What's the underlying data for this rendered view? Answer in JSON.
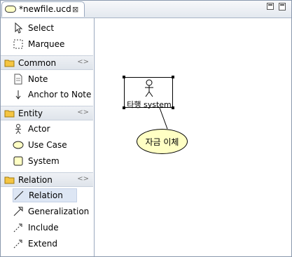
{
  "editor": {
    "tab_title": "*newfile.ucd",
    "close_glyph": "⊠"
  },
  "palette": {
    "tools": [
      {
        "label": "Select",
        "icon": "arrow-cursor-icon"
      },
      {
        "label": "Marquee",
        "icon": "marquee-icon"
      }
    ],
    "sections": [
      {
        "title": "Common",
        "items": [
          {
            "label": "Note",
            "icon": "note-icon"
          },
          {
            "label": "Anchor to Note",
            "icon": "anchor-arrow-icon"
          }
        ]
      },
      {
        "title": "Entity",
        "items": [
          {
            "label": "Actor",
            "icon": "actor-icon"
          },
          {
            "label": "Use Case",
            "icon": "use-case-icon"
          },
          {
            "label": "System",
            "icon": "system-icon"
          }
        ]
      },
      {
        "title": "Relation",
        "items": [
          {
            "label": "Relation",
            "icon": "relation-line-icon",
            "selected": true
          },
          {
            "label": "Generalization",
            "icon": "generalization-icon"
          },
          {
            "label": "Include",
            "icon": "include-icon"
          },
          {
            "label": "Extend",
            "icon": "extend-icon"
          }
        ]
      }
    ]
  },
  "diagram": {
    "system_label": "타행 system",
    "use_case_label": "자금 이체"
  },
  "colors": {
    "use_case_fill": "#ffffc4",
    "selection_bg": "#dde6f4",
    "folder": "#f5c542"
  }
}
